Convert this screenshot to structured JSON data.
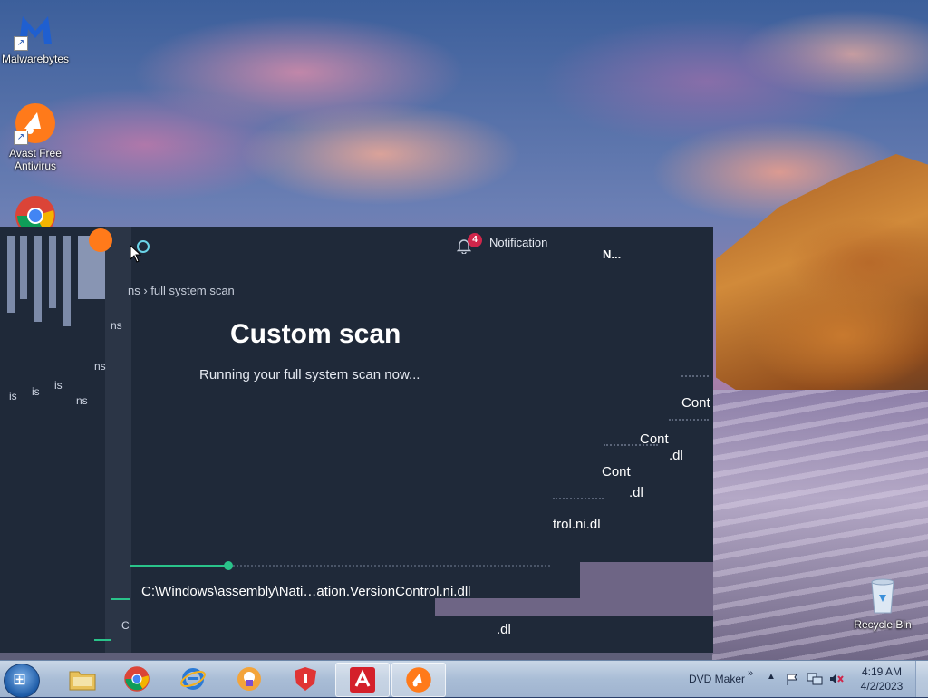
{
  "desktop": {
    "icons": [
      {
        "label": "Malwarebytes"
      },
      {
        "label": "Avast Free Antivirus"
      },
      {
        "label": "Recycle Bin"
      }
    ]
  },
  "avast": {
    "notification_label": "Notification",
    "notification_count": "4",
    "breadcrumb": "full system scan",
    "breadcrumb_fragment": "ns",
    "title": "Custom scan",
    "subtitle": "Running your full system scan now...",
    "current_file": "C:\\Windows\\assembly\\Nati…ation.VersionControl.ni.dll",
    "progress_percent": 30,
    "glitch_fragments": [
      "N...",
      "Cont",
      "Cont",
      ".dl",
      "Cont",
      ".dl",
      "trol.ni.dl",
      ".dl",
      "ns",
      "ns",
      "ns",
      "C",
      "is",
      "is",
      "is"
    ]
  },
  "taskbar": {
    "apps": [
      "windows-explorer",
      "chrome",
      "internet-explorer",
      "avast-secure-browser",
      "avast-shield",
      "avira",
      "avast-antivirus"
    ],
    "tray_label": "DVD Maker",
    "time": "4:19 AM",
    "date": "4/2/2023"
  },
  "colors": {
    "avast_bg": "#1f2939",
    "progress": "#2ac38a",
    "badge": "#d0264b"
  }
}
